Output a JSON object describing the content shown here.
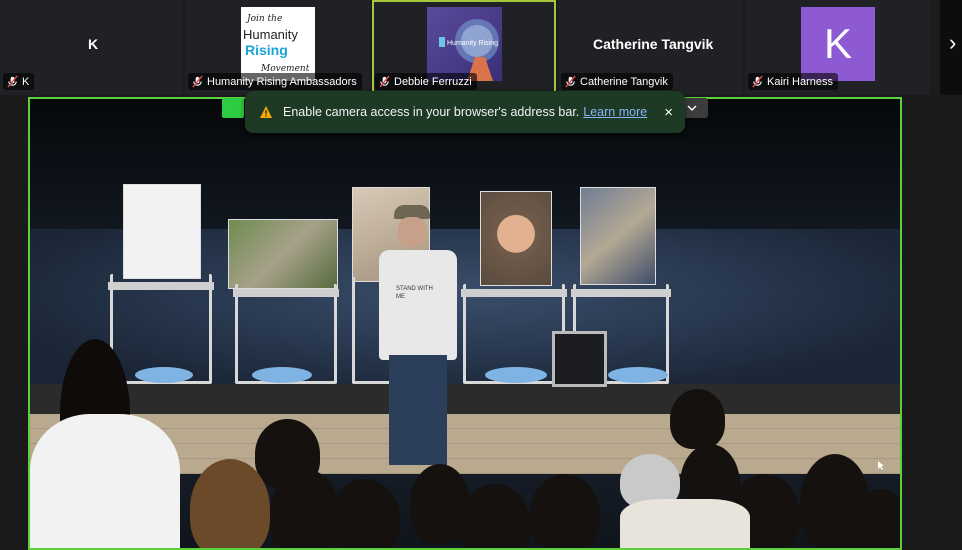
{
  "participants": [
    {
      "initial": "K",
      "name": "K"
    },
    {
      "name": "Humanity Rising Ambassadors"
    },
    {
      "name": "Debbie Ferruzzi"
    },
    {
      "big_name": "Catherine Tangvik",
      "name": "Catherine Tangvik"
    },
    {
      "avatar_letter": "K",
      "name": "Kairi Harness"
    }
  ],
  "logo_white": {
    "line1": "Join the",
    "line2": "Humanity",
    "line3": "Rising",
    "line4": "Movement"
  },
  "logo_purple": {
    "text": "Humanity Rising"
  },
  "notification": {
    "message": "Enable camera access in your browser's address bar.",
    "link": "Learn more",
    "close": "×"
  },
  "next_arrow": "›",
  "shirt_text": "STAND WITH ME",
  "colors": {
    "active_speaker": "#5ad13b",
    "avatar": "#8e5ad3",
    "toast_bg": "#1e3a24",
    "link": "#8ab4f8"
  }
}
